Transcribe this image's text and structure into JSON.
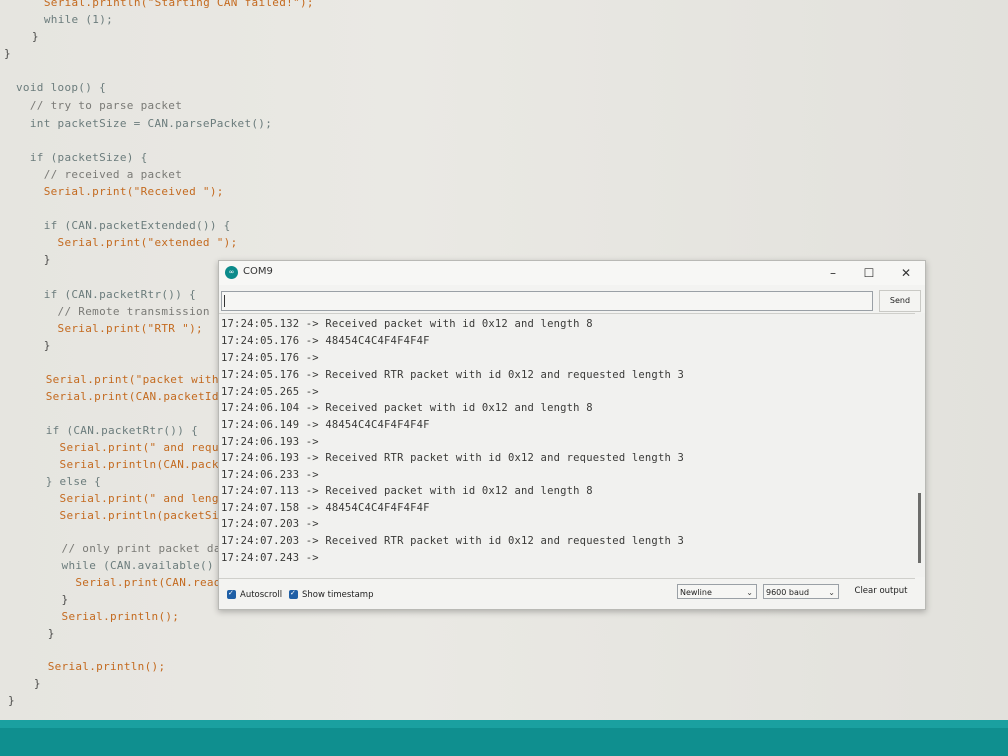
{
  "editor": {
    "lines": [
      "  Serial.println(\"Starting CAN failed!\");",
      "  while (1);",
      "  }",
      "}",
      "void loop() {",
      "  // try to parse packet",
      "  int packetSize = CAN.parsePacket();",
      "  if (packetSize) {",
      "    // received a packet",
      "    Serial.print(\"Received \");",
      "    if (CAN.packetExtended()) {",
      "      Serial.print(\"extended \");",
      "    }",
      "    if (CAN.packetRtr()) {",
      "      // Remote transmission",
      "      Serial.print(\"RTR \");",
      "    }",
      "    Serial.print(\"packet with",
      "    Serial.print(CAN.packetId",
      "    if (CAN.packetRtr()) {",
      "      Serial.print(\" and requ",
      "      Serial.println(CAN.pack",
      "    } else {",
      "      Serial.print(\" and leng",
      "      Serial.println(packetSi",
      "      // only print packet da",
      "      while (CAN.available()",
      "        Serial.print(CAN.read",
      "      }",
      "      Serial.println();",
      "    }",
      "    Serial.println();",
      "  }",
      "}"
    ]
  },
  "monitor": {
    "title": "COM9",
    "send_label": "Send",
    "input_value": "",
    "output_lines": [
      "17:24:05.132 -> Received packet with id 0x12 and length 8",
      "17:24:05.176 -> 48454C4C4F4F4F4F",
      "17:24:05.176 ->",
      "17:24:05.176 -> Received RTR packet with id 0x12 and requested length 3",
      "17:24:05.265 ->",
      "17:24:06.104 -> Received packet with id 0x12 and length 8",
      "17:24:06.149 -> 48454C4C4F4F4F4F",
      "17:24:06.193 ->",
      "17:24:06.193 -> Received RTR packet with id 0x12 and requested length 3",
      "17:24:06.233 ->",
      "17:24:07.113 -> Received packet with id 0x12 and length 8",
      "17:24:07.158 -> 48454C4C4F4F4F4F",
      "17:24:07.203 ->",
      "17:24:07.203 -> Received RTR packet with id 0x12 and requested length 3",
      "17:24:07.243 ->"
    ],
    "autoscroll_label": "Autoscroll",
    "autoscroll_checked": true,
    "timestamp_label": "Show timestamp",
    "timestamp_checked": true,
    "line_ending": "Newline",
    "baud_rate": "9600 baud",
    "clear_label": "Clear output"
  },
  "colors": {
    "accent": "#0f8f8f",
    "checkbox": "#1f5fa6"
  }
}
